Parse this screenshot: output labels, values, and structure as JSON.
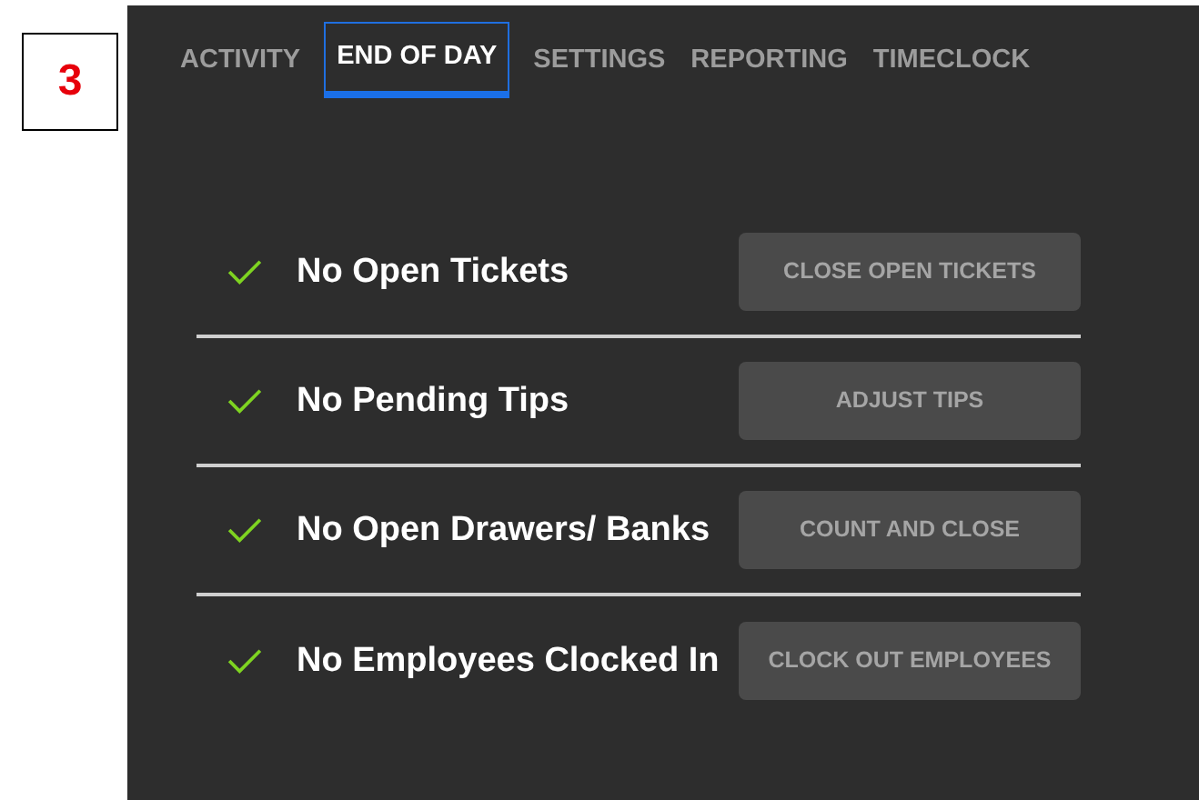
{
  "step_label": "3",
  "tabs": [
    {
      "label": "ACTIVITY",
      "selected": false
    },
    {
      "label": "END OF DAY",
      "selected": true
    },
    {
      "label": "SETTINGS",
      "selected": false
    },
    {
      "label": "REPORTING",
      "selected": false
    },
    {
      "label": "TIMECLOCK",
      "selected": false
    }
  ],
  "checklist": [
    {
      "label": "No Open Tickets",
      "checked": true,
      "button": {
        "label": "CLOSE OPEN TICKETS",
        "disabled": true
      }
    },
    {
      "label": "No Pending Tips",
      "checked": true,
      "button": {
        "label": "ADJUST TIPS",
        "disabled": true
      }
    },
    {
      "label": "No Open Drawers/ Banks",
      "checked": true,
      "button": {
        "label": "COUNT AND CLOSE",
        "disabled": true
      }
    },
    {
      "label": "No Employees Clocked In",
      "checked": true,
      "button": {
        "label": "CLOCK OUT EMPLOYEES",
        "disabled": true
      }
    }
  ]
}
